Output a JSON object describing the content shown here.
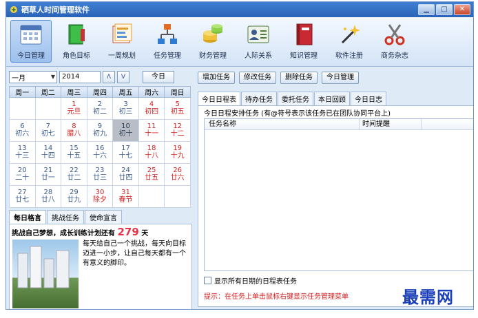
{
  "window": {
    "title": "硒草人时间管理软件"
  },
  "toolbar": {
    "items": [
      {
        "label": "今日管理",
        "icon": "calendar-icon",
        "active": true
      },
      {
        "label": "角色目标",
        "icon": "book-icon"
      },
      {
        "label": "一周规划",
        "icon": "planner-icon"
      },
      {
        "label": "任务管理",
        "icon": "hierarchy-icon"
      },
      {
        "label": "财务管理",
        "icon": "coins-icon"
      },
      {
        "label": "人际关系",
        "icon": "contact-card-icon"
      },
      {
        "label": "知识管理",
        "icon": "notebook-icon"
      },
      {
        "label": "软件注册",
        "icon": "magic-wand-icon"
      },
      {
        "label": "商务杂志",
        "icon": "scissors-icon"
      }
    ]
  },
  "calendar": {
    "month": "一月",
    "year": "2014",
    "prev_symbol": "Λ",
    "next_symbol": "V",
    "today_label": "今日",
    "weekdays": [
      "周一",
      "周二",
      "周三",
      "周四",
      "周五",
      "周六",
      "周日"
    ],
    "weeks": [
      [
        null,
        null,
        {
          "d": "1",
          "l": "元旦",
          "red": true
        },
        {
          "d": "2",
          "l": "初二"
        },
        {
          "d": "3",
          "l": "初三"
        },
        {
          "d": "4",
          "l": "初四",
          "red": true
        },
        {
          "d": "5",
          "l": "初五",
          "red": true
        }
      ],
      [
        {
          "d": "6",
          "l": "初六"
        },
        {
          "d": "7",
          "l": "初七"
        },
        {
          "d": "8",
          "l": "腊八",
          "red": true
        },
        {
          "d": "9",
          "l": "初九"
        },
        {
          "d": "10",
          "l": "初十",
          "selected": true
        },
        {
          "d": "11",
          "l": "十一",
          "red": true
        },
        {
          "d": "12",
          "l": "十二",
          "red": true
        }
      ],
      [
        {
          "d": "13",
          "l": "十三"
        },
        {
          "d": "14",
          "l": "十四"
        },
        {
          "d": "15",
          "l": "十五"
        },
        {
          "d": "16",
          "l": "十六"
        },
        {
          "d": "17",
          "l": "十七"
        },
        {
          "d": "18",
          "l": "十八",
          "red": true
        },
        {
          "d": "19",
          "l": "十九",
          "red": true
        }
      ],
      [
        {
          "d": "20",
          "l": "二十"
        },
        {
          "d": "21",
          "l": "廿一"
        },
        {
          "d": "22",
          "l": "廿二"
        },
        {
          "d": "23",
          "l": "廿三"
        },
        {
          "d": "24",
          "l": "廿四"
        },
        {
          "d": "25",
          "l": "廿五",
          "red": true
        },
        {
          "d": "26",
          "l": "廿六",
          "red": true
        }
      ],
      [
        {
          "d": "27",
          "l": "廿七"
        },
        {
          "d": "28",
          "l": "廿八"
        },
        {
          "d": "29",
          "l": "廿九"
        },
        {
          "d": "30",
          "l": "除夕",
          "red": true
        },
        {
          "d": "31",
          "l": "春节",
          "red": true
        },
        null,
        null
      ]
    ]
  },
  "left_tabs": [
    "每日格言",
    "挑战任务",
    "使命宣言"
  ],
  "motto": {
    "goal_prefix": "挑战自己梦想，成长训练计划还有",
    "goal_days": "279",
    "goal_unit": "天",
    "text": "每天给自己一个挑战，每天向目标迈进一小步，让自己每天都有一个有意义的脚印。"
  },
  "actions": [
    "增加任务",
    "修改任务",
    "删除任务",
    "今日管理"
  ],
  "right_tabs": [
    "今日日程表",
    "待办任务",
    "委托任务",
    "本日回顾",
    "今日日志"
  ],
  "schedule": {
    "legend": "今日日程安排任务 (有@符号表示该任务已在团队协同平台上)",
    "col_name": "任务名称",
    "col_reminder": "时间提醒",
    "show_all_label": "显示所有日期的日程表任务",
    "tip": "提示：在任务上单击鼠标右键显示任务管理菜单"
  },
  "watermark": "最需网",
  "colors": {
    "accent": "#2a63b8",
    "holiday_red": "#d42222",
    "watermark_blue": "#1b3fb8"
  }
}
